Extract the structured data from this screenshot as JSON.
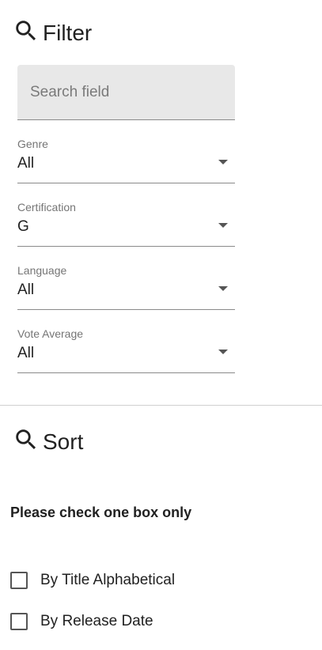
{
  "filter": {
    "heading": "Filter",
    "search": {
      "placeholder": "Search field",
      "value": ""
    },
    "genre": {
      "label": "Genre",
      "value": "All"
    },
    "certification": {
      "label": "Certification",
      "value": "G"
    },
    "language": {
      "label": "Language",
      "value": "All"
    },
    "vote_average": {
      "label": "Vote Average",
      "value": "All"
    }
  },
  "sort": {
    "heading": "Sort",
    "note": "Please check one box only",
    "options": [
      {
        "label": "By Title Alphabetical",
        "checked": false
      },
      {
        "label": "By Release Date",
        "checked": false
      }
    ]
  },
  "icons": {
    "heading_icon": "search-icon",
    "select_arrow": "dropdown-arrow-icon"
  },
  "colors": {
    "field_bg": "#e8e8e8",
    "text": "#212121",
    "label": "#757575"
  }
}
